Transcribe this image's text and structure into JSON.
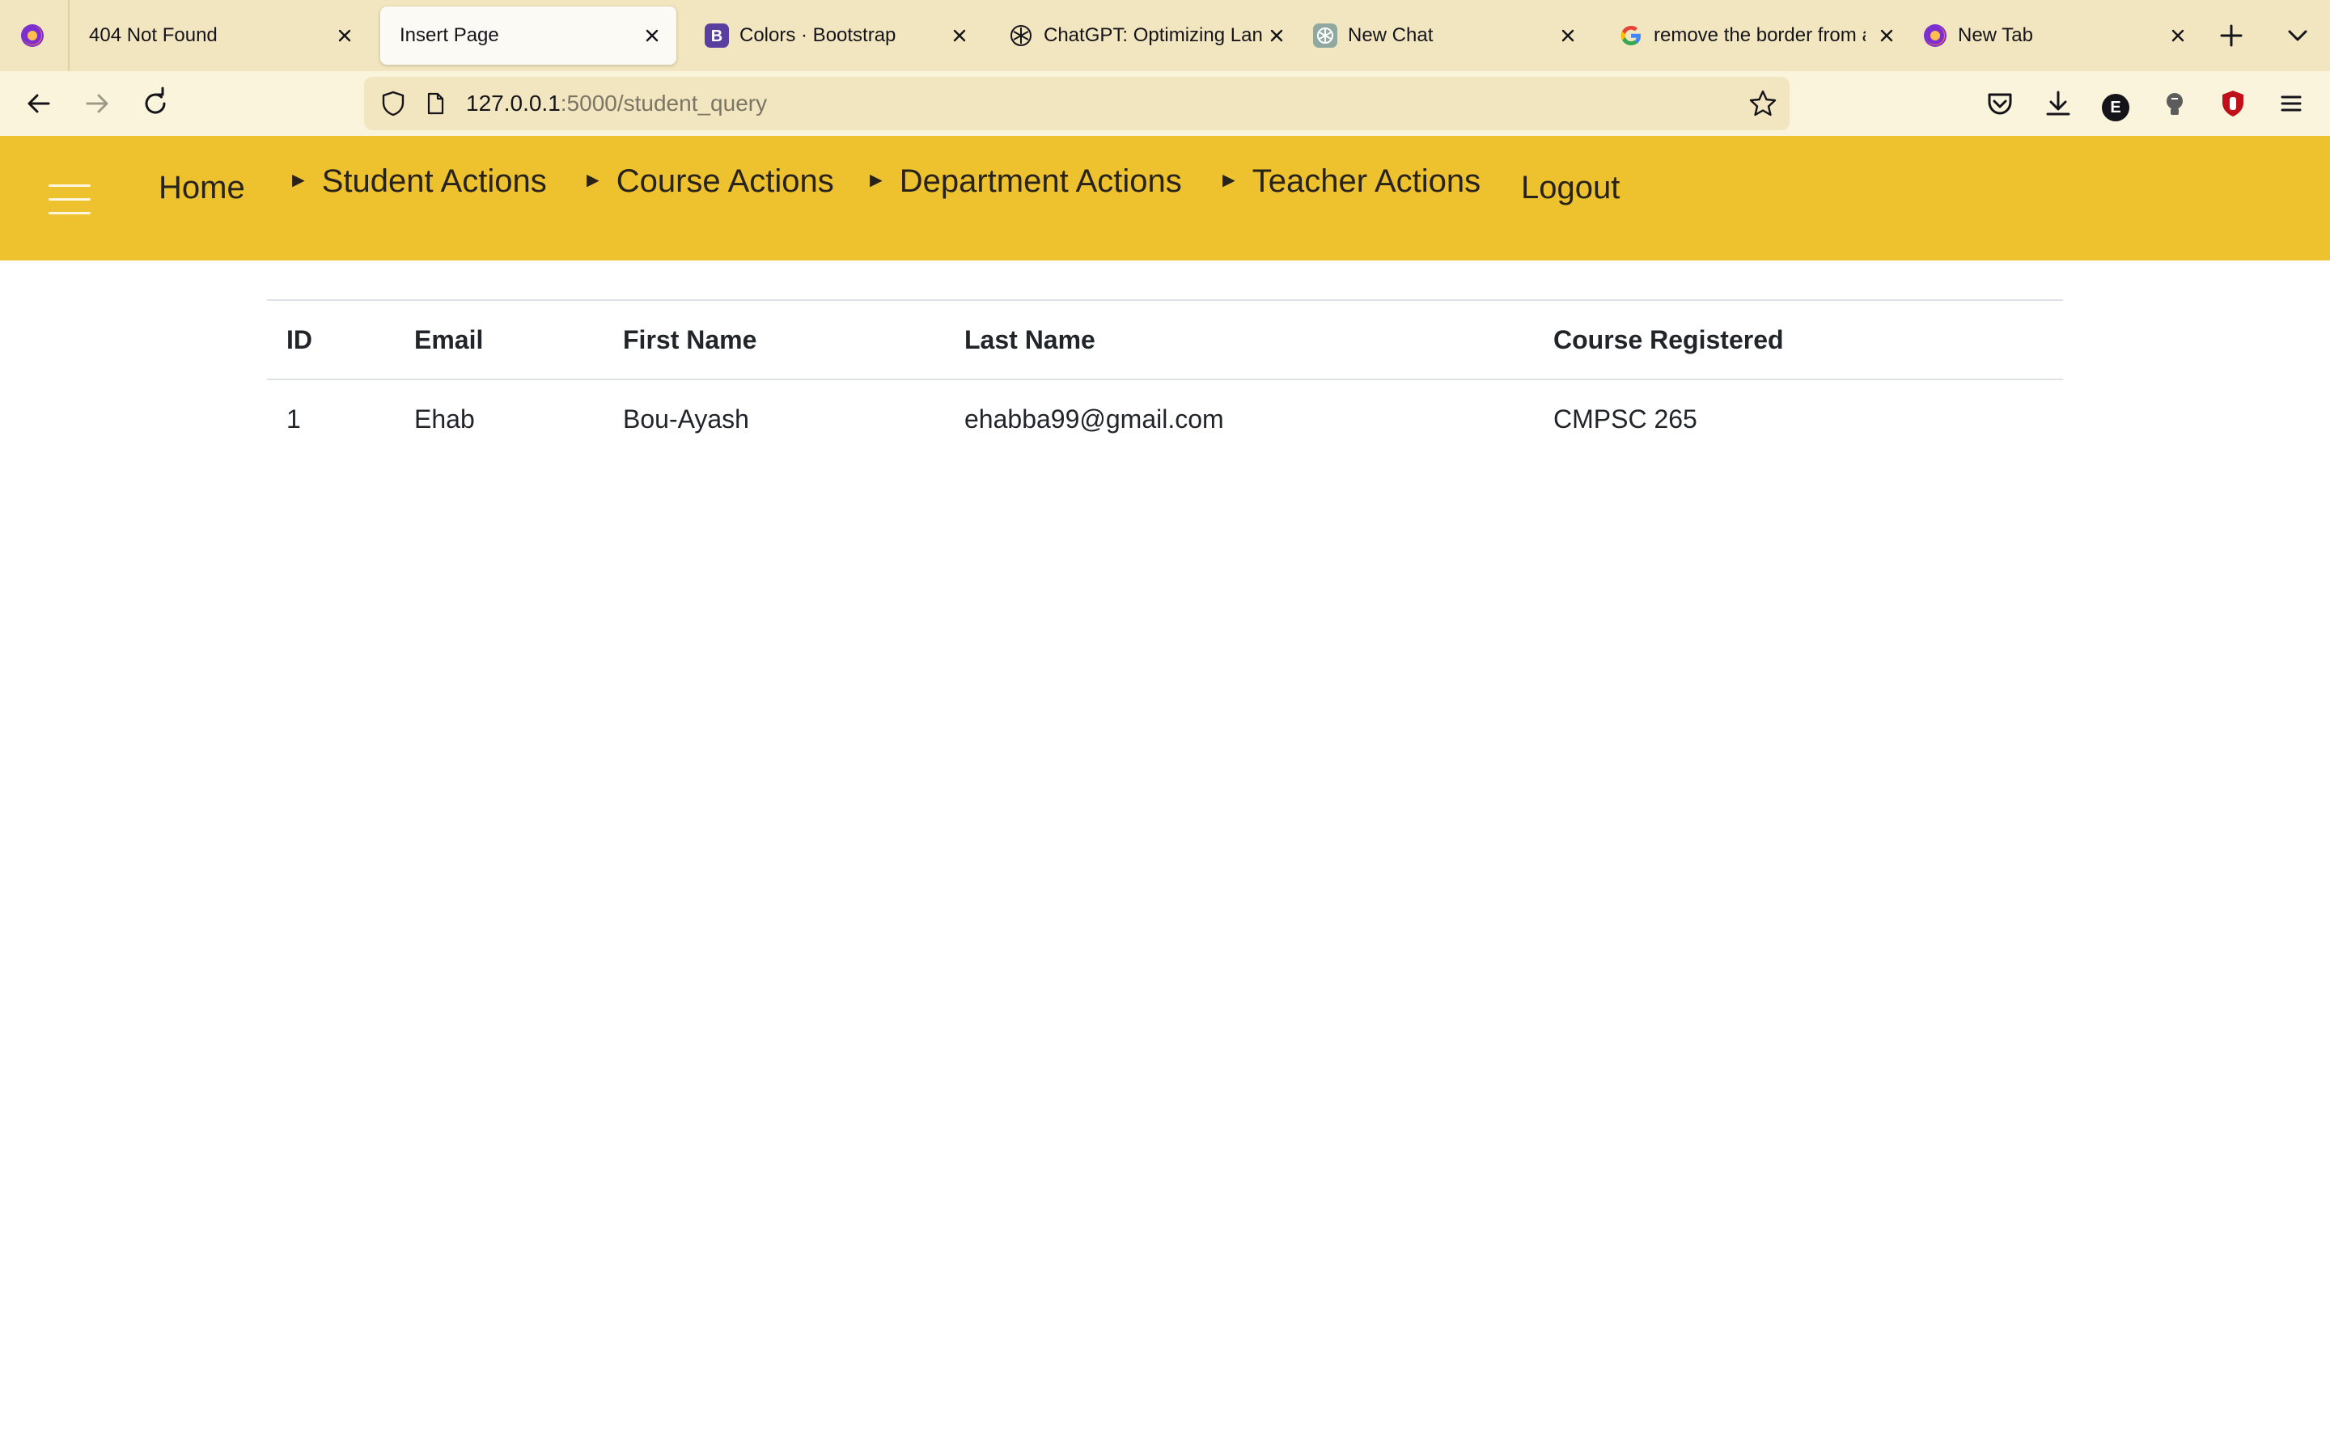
{
  "browser": {
    "tabs": [
      {
        "title": "404 Not Found",
        "favicon": "none",
        "active": false
      },
      {
        "title": "Insert Page",
        "favicon": "none",
        "active": true
      },
      {
        "title": "Colors · Bootstrap",
        "favicon": "bootstrap-icon",
        "active": false
      },
      {
        "title": "ChatGPT: Optimizing Lan",
        "favicon": "openai-icon",
        "active": false
      },
      {
        "title": "New Chat",
        "favicon": "openai-icon",
        "active": false
      },
      {
        "title": "remove the border from a",
        "favicon": "google-icon",
        "active": false
      },
      {
        "title": "New Tab",
        "favicon": "firefox-icon",
        "active": false
      }
    ],
    "url": {
      "host": "127.0.0.1",
      "path": ":5000/student_query"
    },
    "extension_badge": "E"
  },
  "site_nav": {
    "home": "Home",
    "menus": [
      {
        "arrow": "►",
        "label": "Student Actions"
      },
      {
        "arrow": "►",
        "label": "Course Actions"
      },
      {
        "arrow": "►",
        "label": "Department Actions"
      },
      {
        "arrow": "►",
        "label": "Teacher Actions"
      }
    ],
    "logout": "Logout"
  },
  "table": {
    "headers": [
      "ID",
      "Email",
      "First Name",
      "Last Name",
      "Course Registered"
    ],
    "rows": [
      [
        "1",
        "Ehab",
        "Bou-Ayash",
        "ehabba99@gmail.com",
        "CMPSC 265"
      ]
    ]
  },
  "colors": {
    "header_bg": "#eec12f",
    "tabstrip_bg": "#f2e6c0",
    "navbar_bg": "#fbf4dd"
  }
}
